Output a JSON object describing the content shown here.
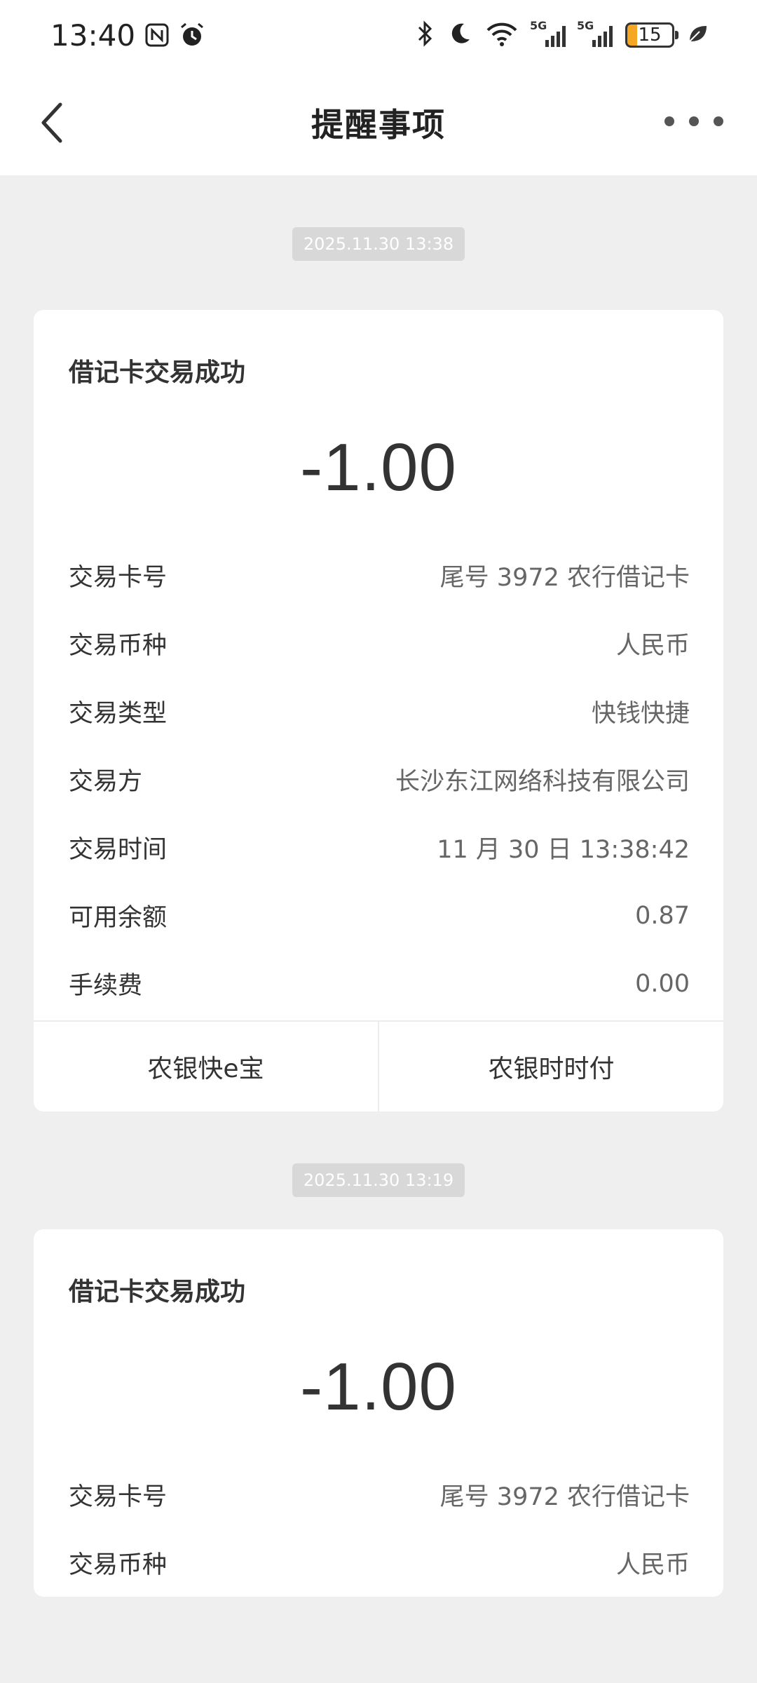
{
  "status_bar": {
    "time": "13:40",
    "battery": "15",
    "signal_label_1": "5G",
    "signal_label_2": "5G"
  },
  "nav": {
    "title": "提醒事项"
  },
  "messages": [
    {
      "timestamp": "2025.11.30 13:38",
      "title": "借记卡交易成功",
      "amount": "-1.00",
      "rows": [
        {
          "label": "交易卡号",
          "value": "尾号 3972 农行借记卡"
        },
        {
          "label": "交易币种",
          "value": "人民币"
        },
        {
          "label": "交易类型",
          "value": "快钱快捷"
        },
        {
          "label": "交易方",
          "value": "长沙东江网络科技有限公司"
        },
        {
          "label": "交易时间",
          "value": "11 月 30 日 13:38:42"
        },
        {
          "label": "可用余额",
          "value": "0.87"
        },
        {
          "label": "手续费",
          "value": "0.00"
        }
      ],
      "actions": [
        "农银快e宝",
        "农银时时付"
      ]
    },
    {
      "timestamp": "2025.11.30 13:19",
      "title": "借记卡交易成功",
      "amount": "-1.00",
      "rows": [
        {
          "label": "交易卡号",
          "value": "尾号 3972 农行借记卡"
        },
        {
          "label": "交易币种",
          "value": "人民币"
        }
      ]
    }
  ]
}
